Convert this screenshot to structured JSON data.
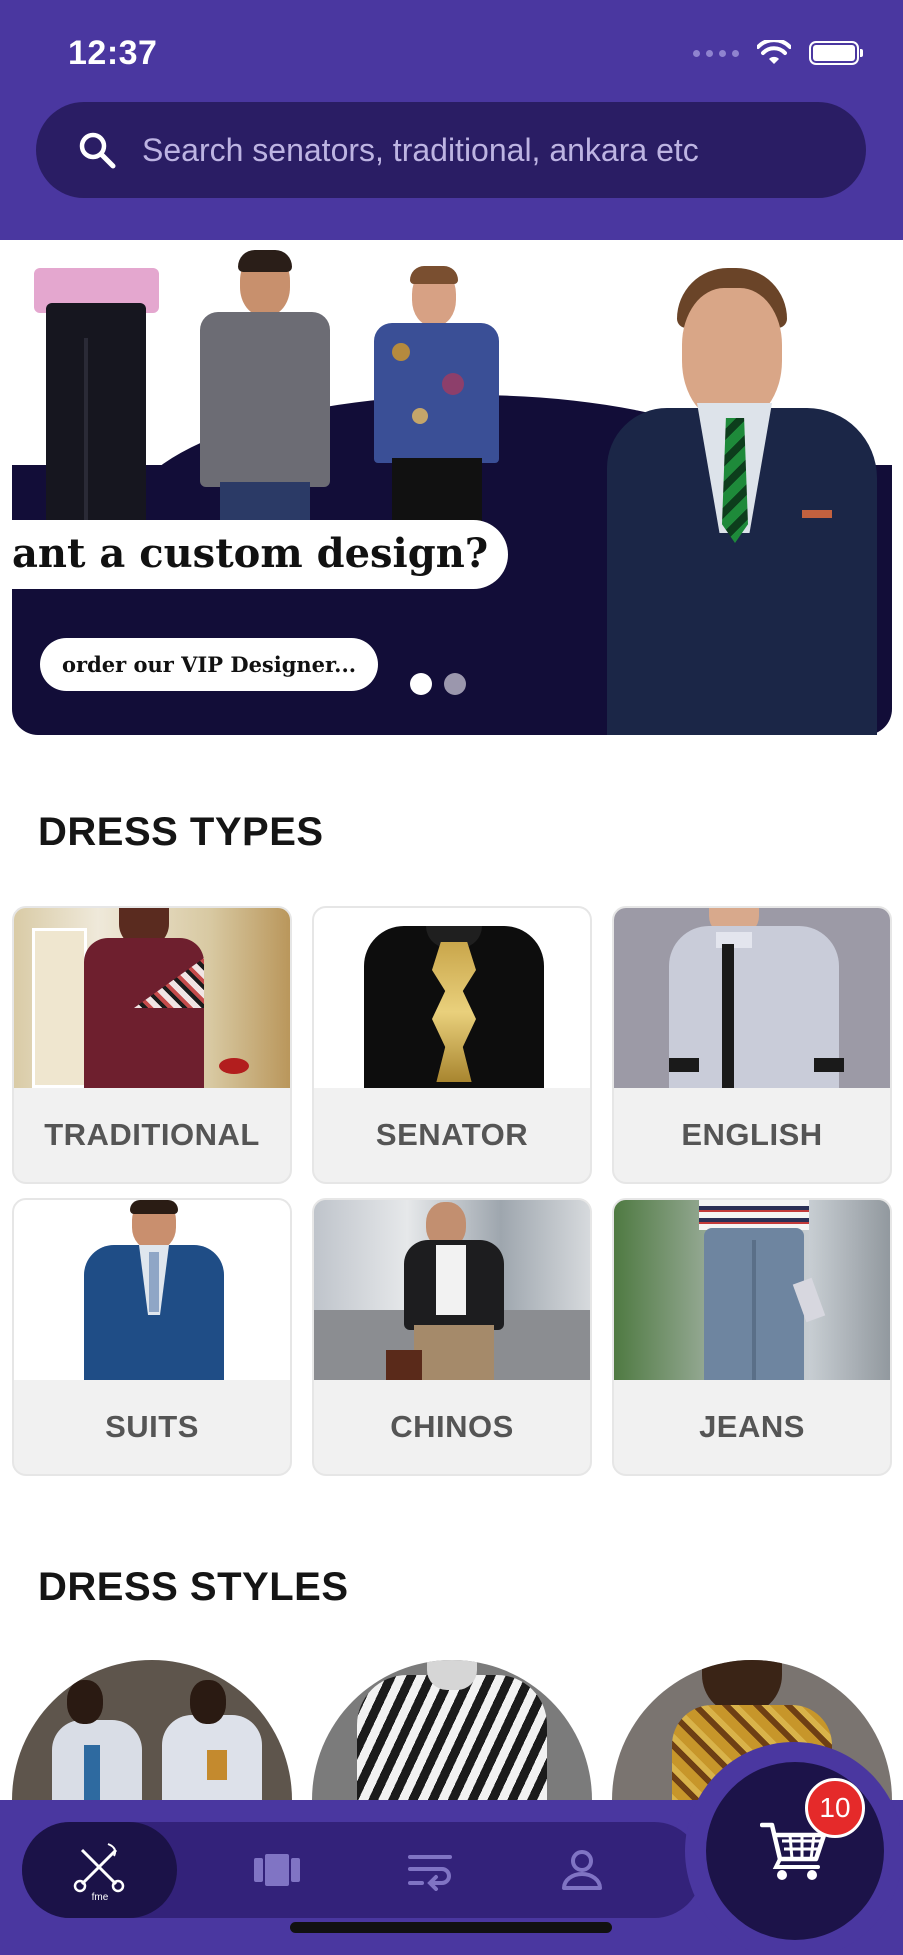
{
  "status_bar": {
    "time": "12:37"
  },
  "search": {
    "placeholder": "Search senators, traditional, ankara etc"
  },
  "banner": {
    "title": "ant a custom design?",
    "cta": "order our VIP Designer...",
    "active_slide": 1,
    "slide_count": 2
  },
  "sections": {
    "dress_types_title": "DRESS TYPES",
    "dress_styles_title": "DRESS STYLES"
  },
  "dress_types": [
    {
      "label": "TRADITIONAL",
      "icon": "traditional-outfit-image"
    },
    {
      "label": "SENATOR",
      "icon": "senator-outfit-image"
    },
    {
      "label": "ENGLISH",
      "icon": "english-shirt-image"
    },
    {
      "label": "SUITS",
      "icon": "suit-image"
    },
    {
      "label": "CHINOS",
      "icon": "chinos-image"
    },
    {
      "label": "JEANS",
      "icon": "jeans-image"
    }
  ],
  "nav": {
    "home_icon_caption": "fme",
    "items": [
      "home-icon",
      "catalog-icon",
      "orders-icon",
      "profile-icon"
    ]
  },
  "cart": {
    "count": "10"
  },
  "colors": {
    "brand_purple": "#4a37a0",
    "search_bg": "#2a1d64",
    "banner_navy": "#120d38",
    "badge_red": "#e52a2a"
  }
}
